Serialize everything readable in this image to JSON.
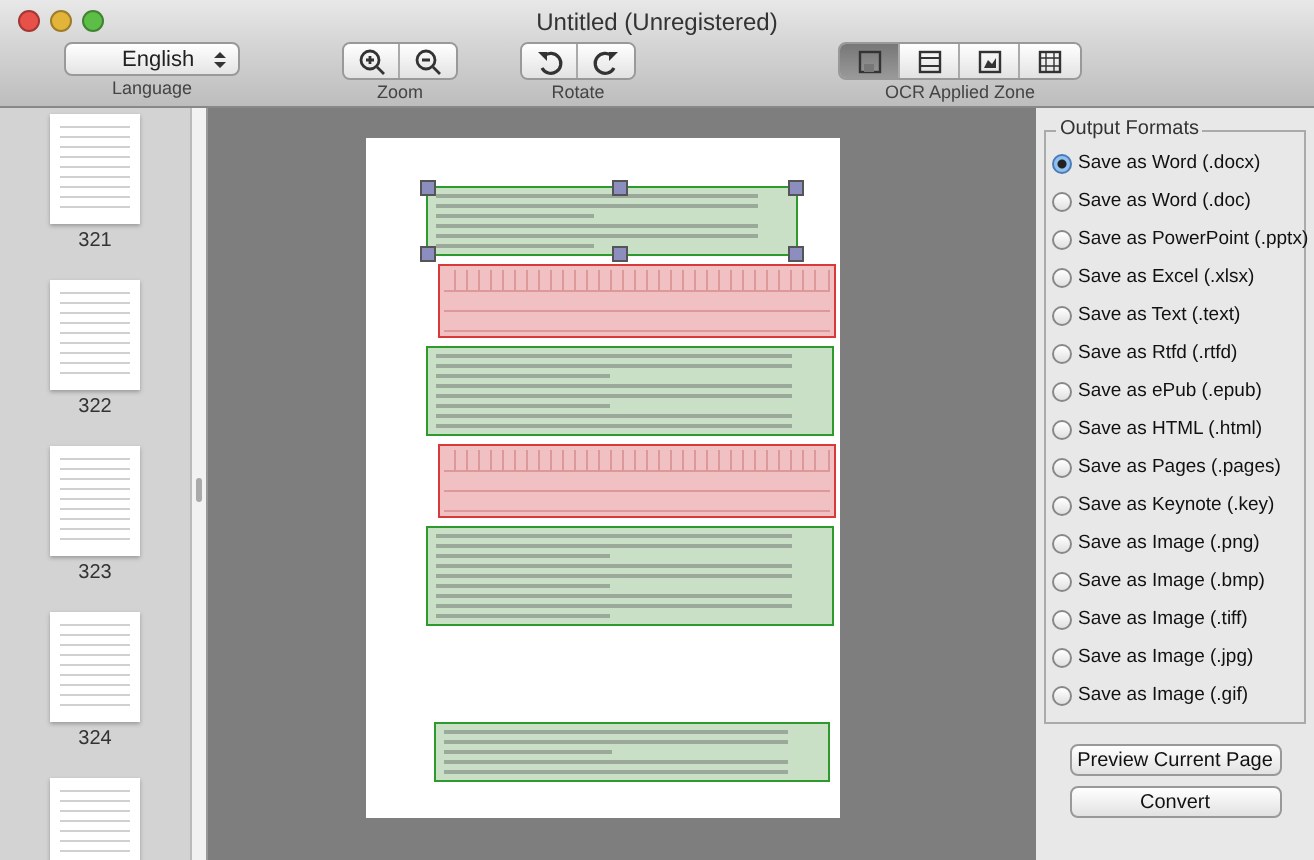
{
  "window": {
    "title": "Untitled (Unregistered)"
  },
  "toolbar": {
    "language": {
      "value": "English",
      "label": "Language"
    },
    "zoom": {
      "label": "Zoom"
    },
    "rotate": {
      "label": "Rotate"
    },
    "ocr_zone": {
      "label": "OCR Applied Zone",
      "modes": [
        {
          "selected": true
        },
        {
          "selected": false
        },
        {
          "selected": false
        },
        {
          "selected": false
        }
      ]
    }
  },
  "thumbnails": [
    {
      "label": "321"
    },
    {
      "label": "322"
    },
    {
      "label": "323"
    },
    {
      "label": "324"
    }
  ],
  "document": {
    "zones": [
      {
        "kind": "text",
        "selected": true
      },
      {
        "kind": "table",
        "selected": false
      },
      {
        "kind": "text",
        "selected": false
      },
      {
        "kind": "table",
        "selected": false
      },
      {
        "kind": "text",
        "selected": false
      },
      {
        "kind": "footer",
        "selected": false
      }
    ]
  },
  "output_formats": {
    "title": "Output Formats",
    "options": [
      {
        "label": "Save as Word (.docx)",
        "selected": true
      },
      {
        "label": "Save as Word (.doc)",
        "selected": false
      },
      {
        "label": "Save as PowerPoint (.pptx)",
        "selected": false
      },
      {
        "label": "Save as Excel (.xlsx)",
        "selected": false
      },
      {
        "label": "Save as Text (.text)",
        "selected": false
      },
      {
        "label": "Save as Rtfd (.rtfd)",
        "selected": false
      },
      {
        "label": "Save as ePub (.epub)",
        "selected": false
      },
      {
        "label": "Save as HTML (.html)",
        "selected": false
      },
      {
        "label": "Save as Pages (.pages)",
        "selected": false
      },
      {
        "label": "Save as Keynote (.key)",
        "selected": false
      },
      {
        "label": "Save as Image (.png)",
        "selected": false
      },
      {
        "label": "Save as Image (.bmp)",
        "selected": false
      },
      {
        "label": "Save as Image (.tiff)",
        "selected": false
      },
      {
        "label": "Save as Image (.jpg)",
        "selected": false
      },
      {
        "label": "Save as Image (.gif)",
        "selected": false
      }
    ]
  },
  "buttons": [
    {
      "label": "Preview Current Page"
    },
    {
      "label": "Convert"
    }
  ]
}
